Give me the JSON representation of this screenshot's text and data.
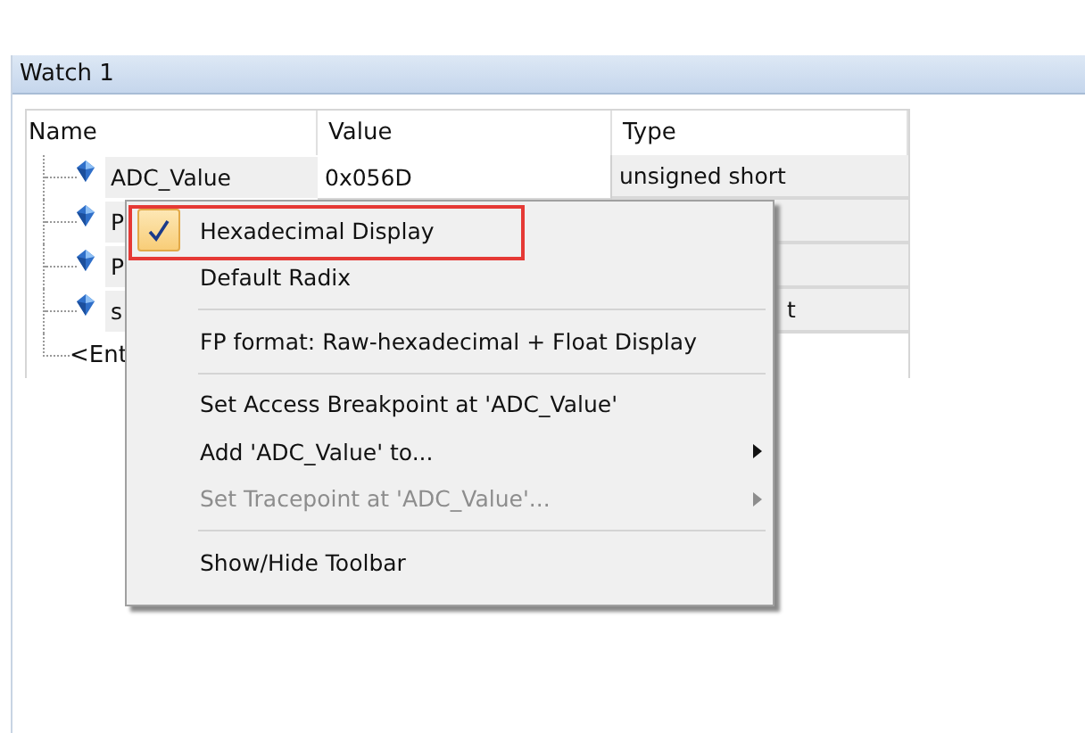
{
  "window": {
    "title": "Watch 1"
  },
  "table": {
    "columns": [
      "Name",
      "Value",
      "Type"
    ],
    "rows": [
      {
        "name": "ADC_Value",
        "value": "0x056D",
        "type": "unsigned short"
      },
      {
        "name": "P"
      },
      {
        "name": "P"
      },
      {
        "name": "s",
        "type": "t"
      }
    ],
    "entry_row": {
      "name": "<Ent"
    }
  },
  "context_menu": {
    "items": [
      {
        "kind": "item",
        "label": "Hexadecimal Display",
        "checked": true,
        "disabled": false,
        "submenu": false,
        "annotated": true
      },
      {
        "kind": "item",
        "label": "Default Radix",
        "checked": false,
        "disabled": false,
        "submenu": false,
        "annotated": false
      },
      {
        "kind": "separator"
      },
      {
        "kind": "item",
        "label": "FP format: Raw-hexadecimal + Float Display",
        "checked": false,
        "disabled": false,
        "submenu": false,
        "annotated": false
      },
      {
        "kind": "separator"
      },
      {
        "kind": "item",
        "label": "Set Access Breakpoint at 'ADC_Value'",
        "checked": false,
        "disabled": false,
        "submenu": false,
        "annotated": false
      },
      {
        "kind": "item",
        "label": "Add 'ADC_Value' to...",
        "checked": false,
        "disabled": false,
        "submenu": true,
        "annotated": false
      },
      {
        "kind": "item",
        "label": "Set Tracepoint at 'ADC_Value'...",
        "checked": false,
        "disabled": true,
        "submenu": true,
        "annotated": false
      },
      {
        "kind": "separator"
      },
      {
        "kind": "item",
        "label": "Show/Hide Toolbar",
        "checked": false,
        "disabled": false,
        "submenu": false,
        "annotated": false
      }
    ]
  }
}
